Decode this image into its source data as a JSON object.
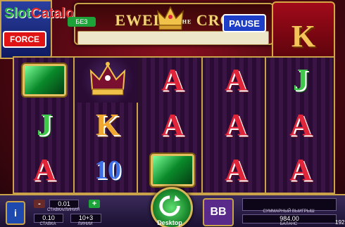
{
  "header": {
    "logo_slot": "Slot",
    "logo_catalog": "Catalog",
    "title_left": "EWEL",
    "title_mid": "IN THE",
    "title_right": "CRO",
    "force_label": "FORCE",
    "green_button_label": "БЕЗ",
    "pause_label": "PAUSE",
    "corner_symbol": "K"
  },
  "reels": [
    [
      "emerald",
      "J",
      "A"
    ],
    [
      "crown",
      "K",
      "10"
    ],
    [
      "A",
      "A",
      "emerald"
    ],
    [
      "A",
      "A",
      "A"
    ],
    [
      "J",
      "A",
      "A"
    ]
  ],
  "bottom": {
    "info_label": "i",
    "coin_value": "0.01",
    "coin_caption": "СТАВКА/ЛИНИЯ",
    "bet_value": "0.10",
    "bet_caption": "СТАВКА",
    "lines_value": "10+3",
    "lines_caption": "ЛИНИИ",
    "minus_label": "-",
    "plus_label": "+",
    "spin_label": "Desktop",
    "bb_label": "BB",
    "win_caption": "СУММАРНЫЙ ВЫИГРЫШ",
    "balance_value": "984.00",
    "balance_caption": "БАЛАНС",
    "corner_number": "192"
  },
  "colors": {
    "gold": "#c9a24a",
    "red_letter": "#e0253a",
    "orange_letter": "#f0a830",
    "green_letter": "#3fc84a",
    "blue_letter": "#3d6fe8"
  }
}
